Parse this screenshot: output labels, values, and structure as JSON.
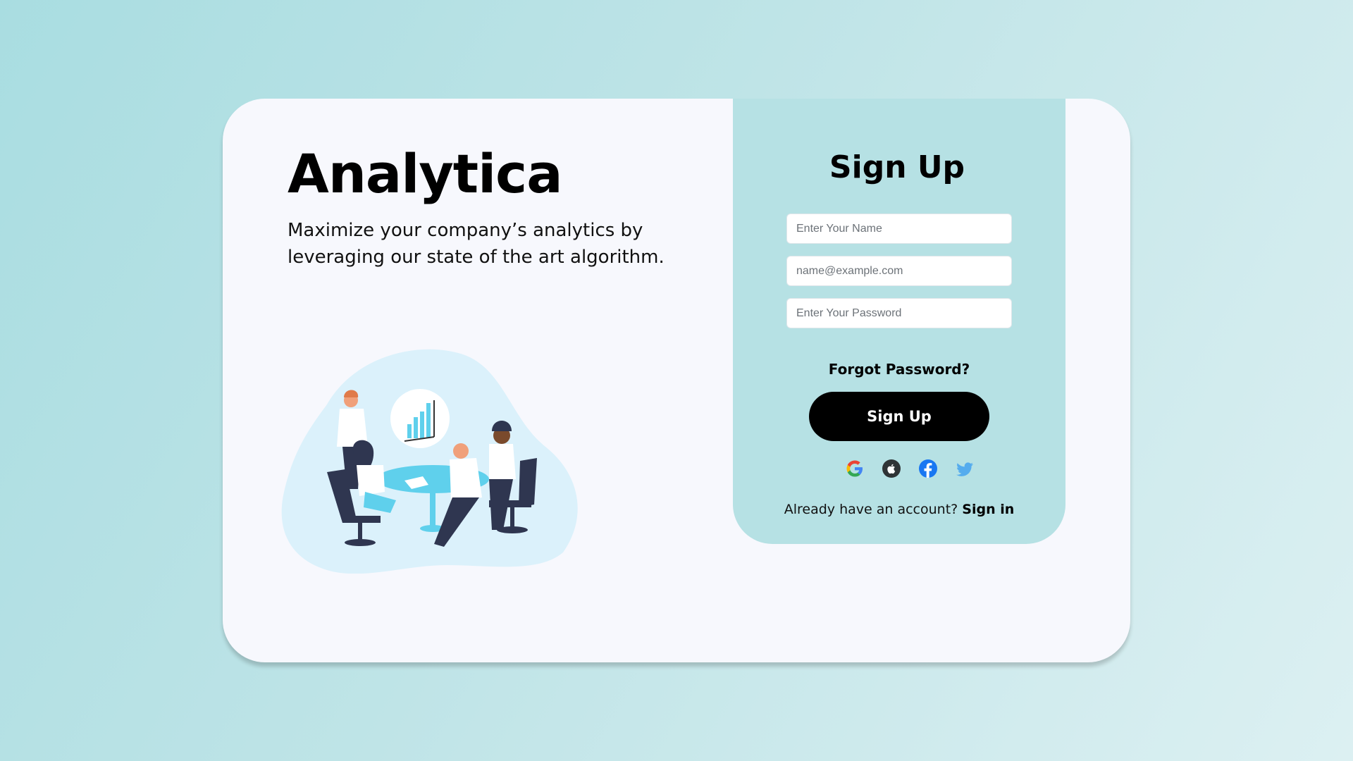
{
  "brand": {
    "title": "Analytica",
    "tagline": "Maximize your company’s analytics by leveraging our state of the art algorithm."
  },
  "form": {
    "title": "Sign Up",
    "name_placeholder": "Enter Your Name",
    "email_placeholder": "name@example.com",
    "password_placeholder": "Enter Your Password",
    "forgot_label": "Forgot Password?",
    "submit_label": "Sign Up",
    "social_icons": [
      "google-icon",
      "apple-icon",
      "facebook-icon",
      "twitter-icon"
    ],
    "signin_prompt": "Already have an account?",
    "signin_link": "Sign in"
  },
  "colors": {
    "background": "#b9e2e6",
    "card": "#f7f8fd",
    "panel": "#b6e1e4",
    "button": "#000000",
    "illustration_blob": "#dbf1fb",
    "illustration_accent": "#5fd0ec",
    "facebook": "#1877f2",
    "twitter": "#55acee"
  }
}
